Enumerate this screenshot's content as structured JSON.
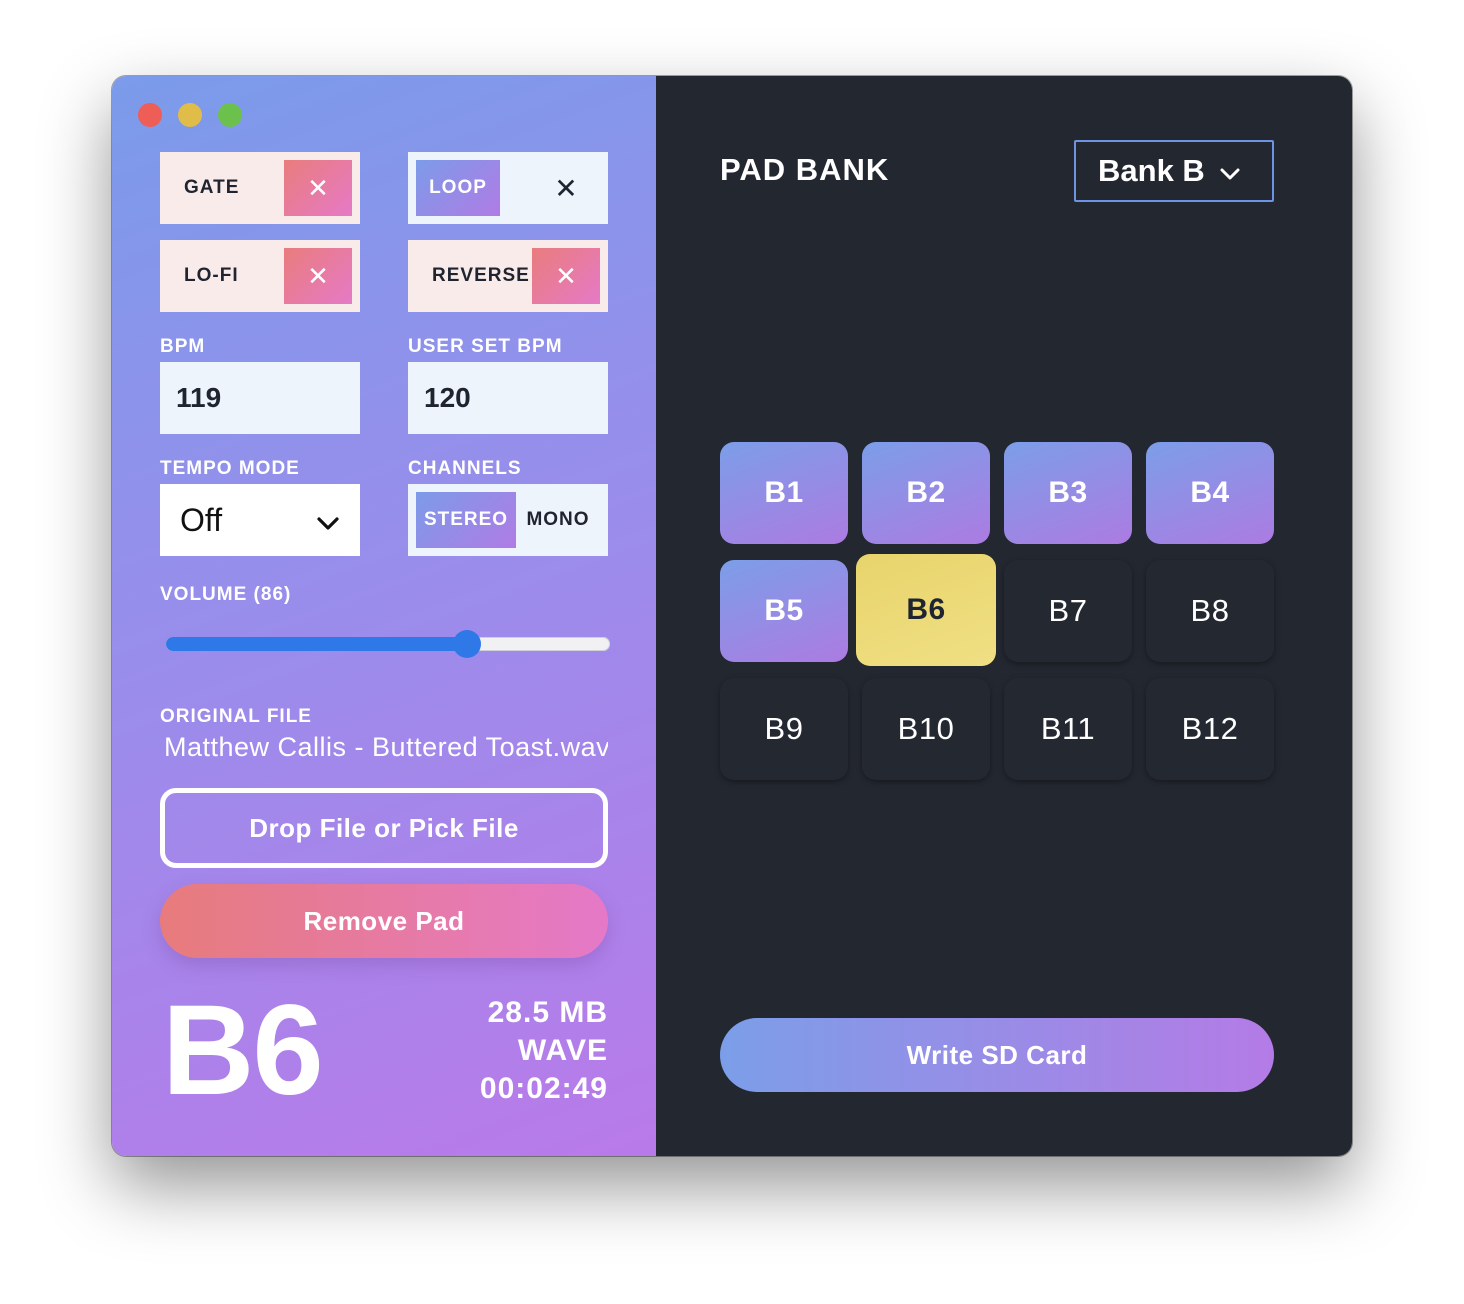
{
  "toggles": {
    "gate": {
      "label": "GATE",
      "x": "✕"
    },
    "loop": {
      "label": "LOOP",
      "x": "✕"
    },
    "lofi": {
      "label": "LO-FI",
      "x": "✕"
    },
    "reverse": {
      "label": "REVERSE",
      "x": "✕"
    }
  },
  "bpm": {
    "label": "BPM",
    "value": "119"
  },
  "user_bpm": {
    "label": "USER SET BPM",
    "value": "120"
  },
  "tempo_mode": {
    "label": "TEMPO MODE",
    "value": "Off"
  },
  "channels": {
    "label": "CHANNELS",
    "options": [
      "STEREO",
      "MONO"
    ]
  },
  "volume": {
    "label": "VOLUME (86)",
    "value": 86,
    "max": 127
  },
  "original_file": {
    "label": "ORIGINAL FILE",
    "name": "Matthew Callis - Buttered Toast.wav"
  },
  "buttons": {
    "drop": "Drop File or Pick File",
    "remove": "Remove Pad",
    "write": "Write SD Card"
  },
  "selected_pad": {
    "name": "B6",
    "size": "28.5 MB",
    "format": "WAVE",
    "duration": "00:02:49"
  },
  "pad_bank": {
    "title": "PAD BANK",
    "bank": "Bank B",
    "pads": [
      {
        "label": "B1",
        "state": "filled"
      },
      {
        "label": "B2",
        "state": "filled"
      },
      {
        "label": "B3",
        "state": "filled"
      },
      {
        "label": "B4",
        "state": "filled"
      },
      {
        "label": "B5",
        "state": "filled"
      },
      {
        "label": "B6",
        "state": "selected"
      },
      {
        "label": "B7",
        "state": "empty"
      },
      {
        "label": "B8",
        "state": "empty"
      },
      {
        "label": "B9",
        "state": "empty"
      },
      {
        "label": "B10",
        "state": "empty"
      },
      {
        "label": "B11",
        "state": "empty"
      },
      {
        "label": "B12",
        "state": "empty"
      }
    ]
  },
  "colors": {
    "accent_blue": "#2f78e8",
    "selected_pad": "#e8d46c",
    "dark_bg": "#232730"
  }
}
